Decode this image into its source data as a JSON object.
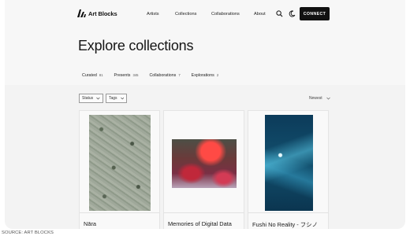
{
  "brand": {
    "name": "Art Blocks"
  },
  "nav": {
    "artists": "Artists",
    "collections": "Collections",
    "collaborations": "Collaborations",
    "about": "About"
  },
  "header": {
    "connect_label": "CONNECT",
    "search_icon": "search-icon",
    "theme_icon": "moon-icon"
  },
  "page": {
    "title": "Explore collections"
  },
  "tabs": [
    {
      "label": "Curated",
      "count": "81"
    },
    {
      "label": "Presents",
      "count": "345"
    },
    {
      "label": "Collaborations",
      "count": "7"
    },
    {
      "label": "Explorations",
      "count": "2"
    }
  ],
  "filters": {
    "status": "Status",
    "tags": "Tags",
    "sort": "Newest"
  },
  "cards": [
    {
      "title": "Nāra"
    },
    {
      "title": "Memories of Digital Data"
    },
    {
      "title": "Fushi No Reality - フシノ"
    }
  ],
  "footer": {
    "source": "SOURCE: ART BLOCKS"
  },
  "colors": {
    "accent": "#111111",
    "background": "#f3f3f3"
  }
}
